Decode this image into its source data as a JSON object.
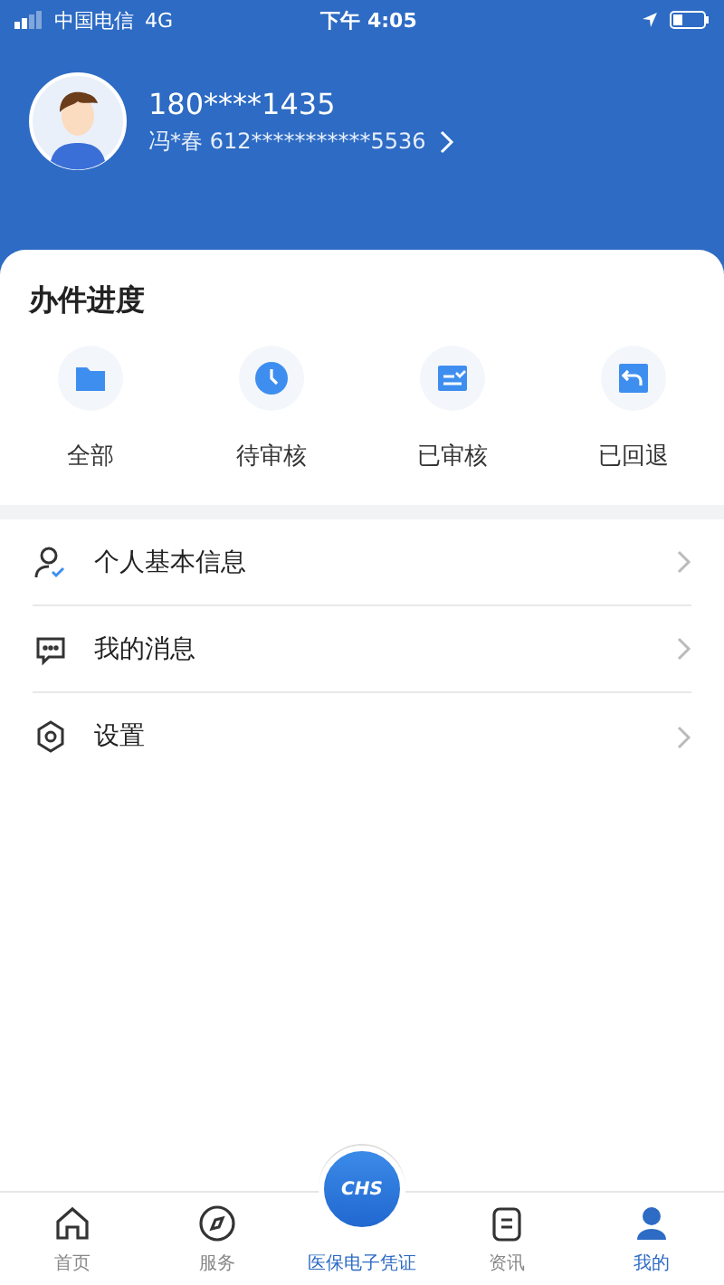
{
  "status_bar": {
    "carrier": "中国电信",
    "network": "4G",
    "time": "下午 4:05"
  },
  "profile": {
    "phone": "180****1435",
    "name_id": "冯*春 612***********5536"
  },
  "progress": {
    "title": "办件进度",
    "items": [
      {
        "label": "全部"
      },
      {
        "label": "待审核"
      },
      {
        "label": "已审核"
      },
      {
        "label": "已回退"
      }
    ]
  },
  "menu": [
    {
      "label": "个人基本信息"
    },
    {
      "label": "我的消息"
    },
    {
      "label": "设置"
    }
  ],
  "tab_bar": [
    {
      "label": "首页",
      "kind": "tab",
      "selected": false
    },
    {
      "label": "服务",
      "kind": "tab",
      "selected": false
    },
    {
      "label": "医保电子凭证",
      "kind": "center",
      "logo": "CHS"
    },
    {
      "label": "资讯",
      "kind": "tab",
      "selected": false
    },
    {
      "label": "我的",
      "kind": "tab",
      "selected": true
    }
  ]
}
